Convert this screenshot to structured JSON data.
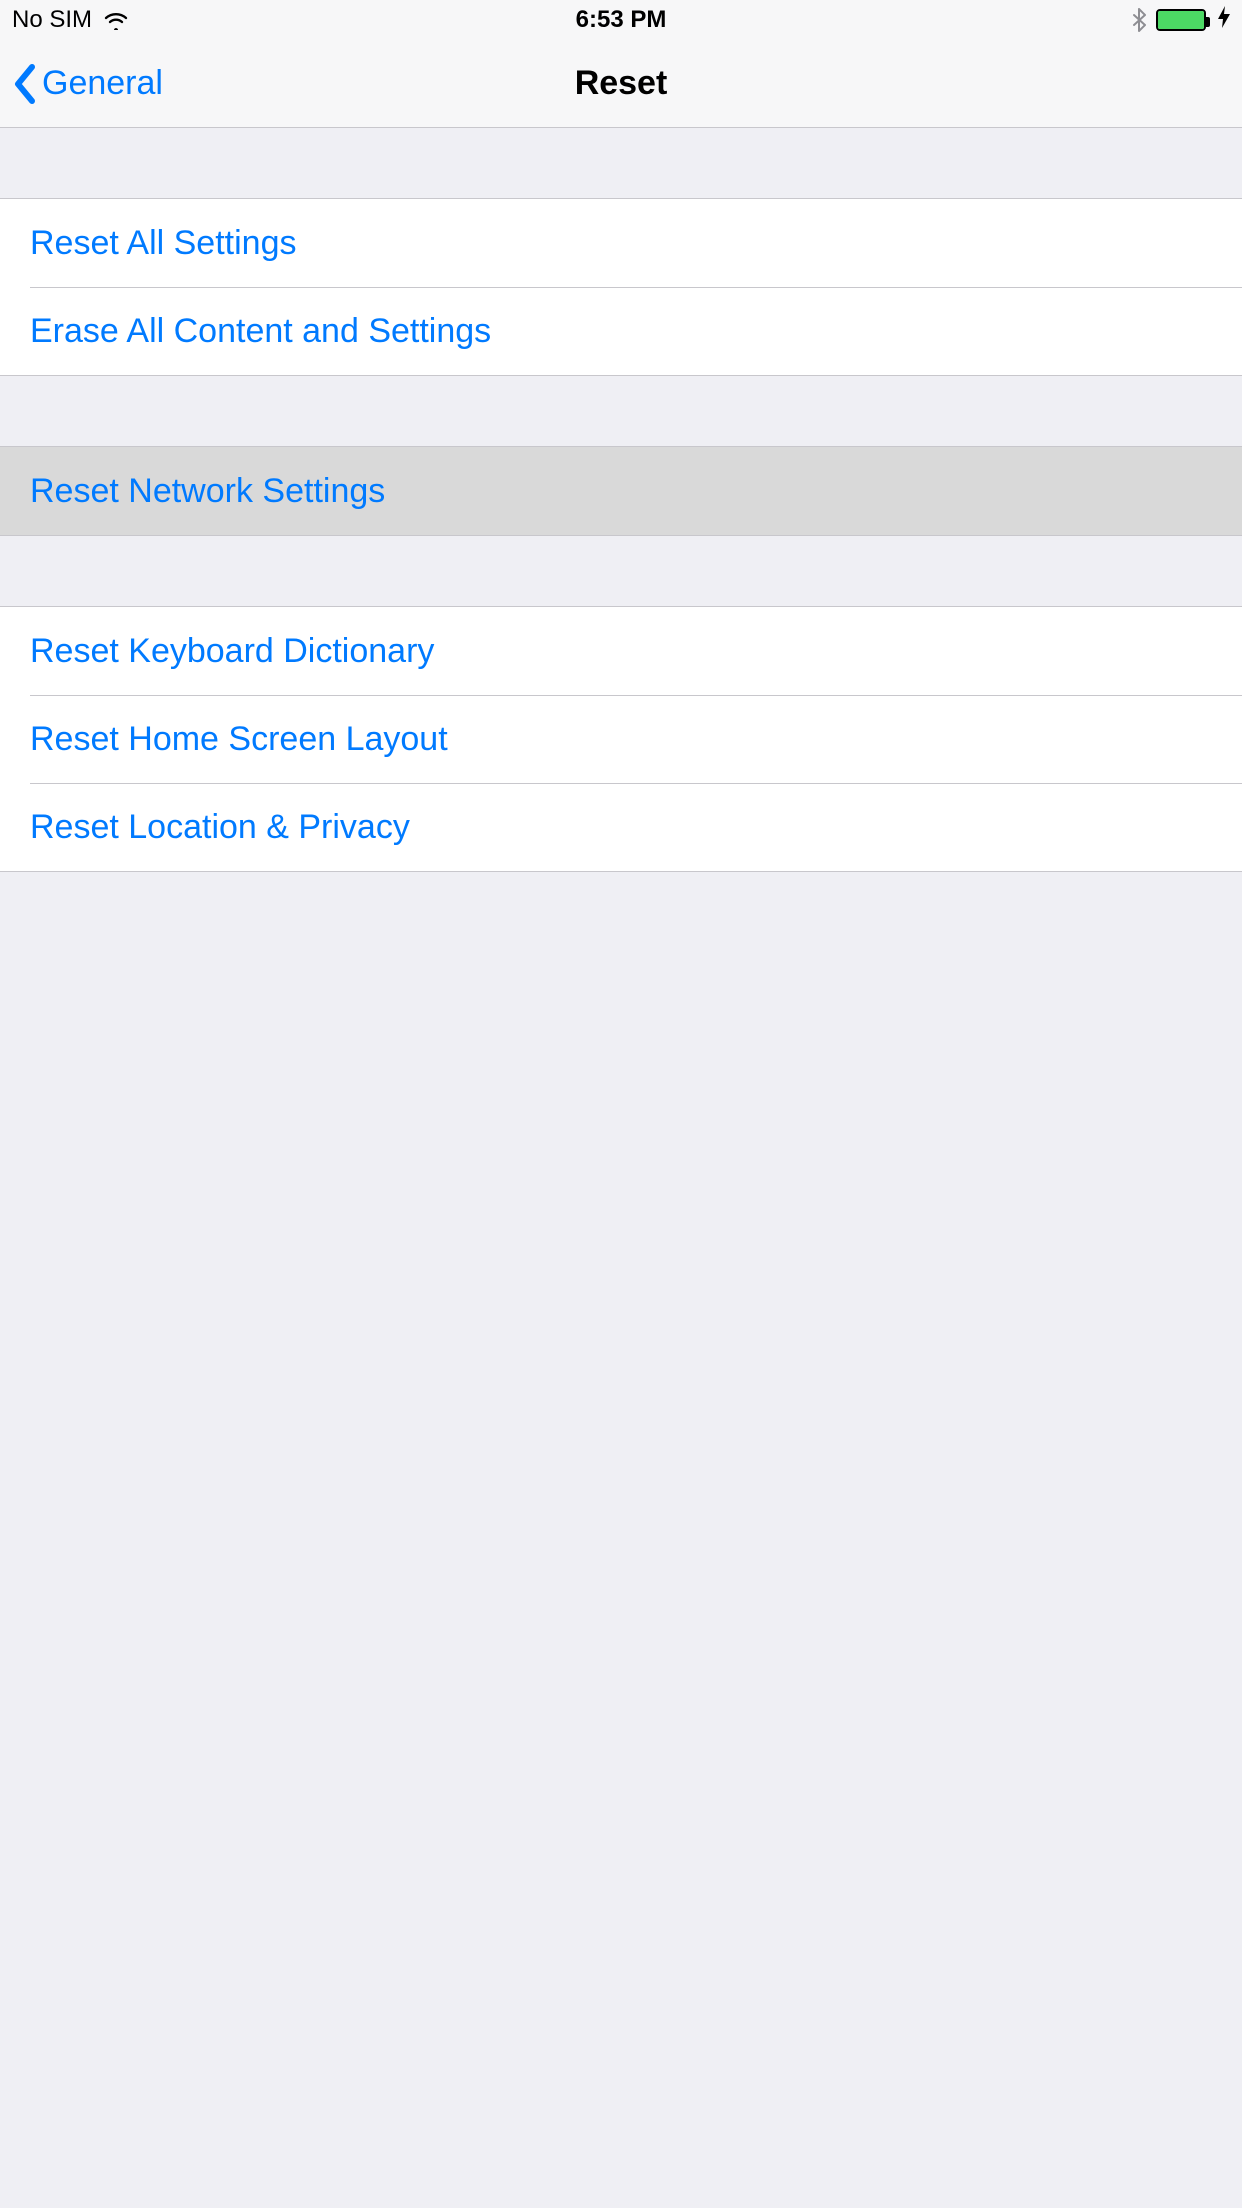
{
  "status_bar": {
    "carrier": "No SIM",
    "time": "6:53 PM"
  },
  "nav": {
    "back_label": "General",
    "title": "Reset"
  },
  "sections": {
    "main1": {
      "reset_all": "Reset All Settings",
      "erase_all": "Erase All Content and Settings"
    },
    "network": {
      "reset_network": "Reset Network Settings"
    },
    "misc": {
      "reset_keyboard": "Reset Keyboard Dictionary",
      "reset_home": "Reset Home Screen Layout",
      "reset_location": "Reset Location & Privacy"
    }
  },
  "colors": {
    "link": "#007aff",
    "bg": "#efeff4",
    "separator": "#c8c7cc",
    "highlight": "#d9d9d9",
    "battery_fill": "#4cd964"
  }
}
